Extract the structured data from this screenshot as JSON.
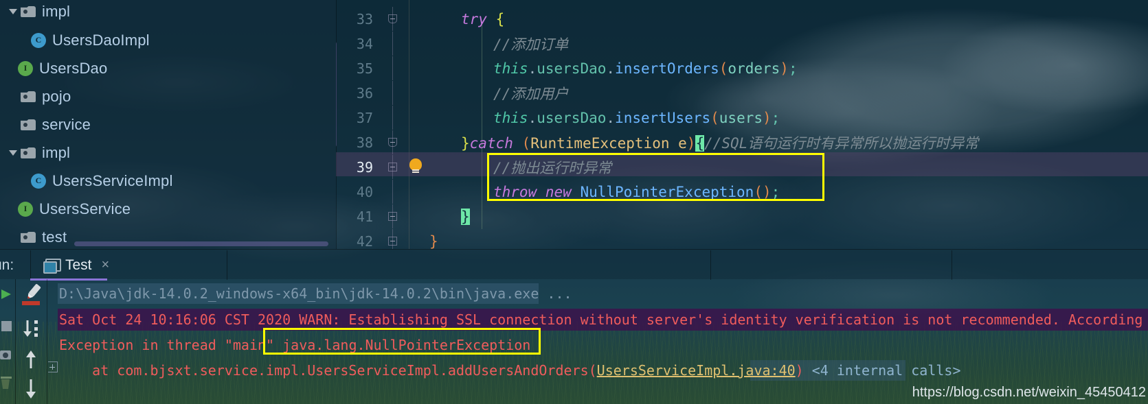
{
  "project_tree": {
    "items": [
      {
        "label": "impl",
        "icon": "folder-icon",
        "arrow": "expanded",
        "indent": 0,
        "kind": "folder"
      },
      {
        "label": "UsersDaoImpl",
        "icon": "class-icon",
        "arrow": "none",
        "indent": 1,
        "kind": "class"
      },
      {
        "label": "UsersDao",
        "icon": "interface-icon",
        "arrow": "none",
        "indent": 1,
        "kind": "interface"
      },
      {
        "label": "pojo",
        "icon": "folder-icon",
        "arrow": "none",
        "indent": 0,
        "kind": "folder"
      },
      {
        "label": "service",
        "icon": "folder-icon",
        "arrow": "none",
        "indent": 0,
        "kind": "folder"
      },
      {
        "label": "impl",
        "icon": "folder-icon",
        "arrow": "expanded",
        "indent": 0,
        "kind": "folder"
      },
      {
        "label": "UsersServiceImpl",
        "icon": "class-icon",
        "arrow": "none",
        "indent": 1,
        "kind": "class"
      },
      {
        "label": "UsersService",
        "icon": "interface-icon",
        "arrow": "none",
        "indent": 1,
        "kind": "interface"
      },
      {
        "label": "test",
        "icon": "folder-icon",
        "arrow": "none",
        "indent": 0,
        "kind": "folder"
      }
    ],
    "badge_letters": {
      "class": "C",
      "interface": "I"
    }
  },
  "editor": {
    "current_line": 39,
    "lines": [
      {
        "no": "33",
        "fold": "pointed"
      },
      {
        "no": "34",
        "fold": "none"
      },
      {
        "no": "35",
        "fold": "none"
      },
      {
        "no": "36",
        "fold": "none"
      },
      {
        "no": "37",
        "fold": "none"
      },
      {
        "no": "38",
        "fold": "pointed"
      },
      {
        "no": "39",
        "fold": "box"
      },
      {
        "no": "40",
        "fold": "none"
      },
      {
        "no": "41",
        "fold": "box"
      },
      {
        "no": "42",
        "fold": "box"
      }
    ],
    "code": {
      "l33_try": "try",
      "l33_brace": "{",
      "l34_comment": "//添加订单",
      "l35_this": "this",
      "l35_dot1": ".",
      "l35_field": "usersDao",
      "l35_dot2": ".",
      "l35_method": "insertOrders",
      "l35_paren_open": "(",
      "l35_arg": "orders",
      "l35_paren_close": ")",
      "l35_semi": ";",
      "l36_comment": "//添加用户",
      "l37_this": "this",
      "l37_dot1": ".",
      "l37_field": "usersDao",
      "l37_dot2": ".",
      "l37_method": "insertUsers",
      "l37_paren_open": "(",
      "l37_arg": "users",
      "l37_paren_close": ")",
      "l37_semi": ";",
      "l38_close_brace": "}",
      "l38_catch": "catch",
      "l38_paren_open": "(",
      "l38_type": "RuntimeException",
      "l38_var": " e",
      "l38_paren_close": ")",
      "l38_brace_matched": "{",
      "l38_comment": "//SQL语句运行时有异常所以抛运行时异常",
      "l39_comment": "//抛出运行时异常",
      "l40_throw": "throw",
      "l40_new": "new",
      "l40_class": "NullPointerException",
      "l40_parens": "()",
      "l40_semi": ";",
      "l41_brace_matched": "}",
      "l42_brace": "}"
    },
    "bulb_tooltip_icon": "lightbulb-icon",
    "highlight_color": "#ffff00"
  },
  "tool_window": {
    "run_label": "un:",
    "tab_title": "Test",
    "tab_close": "×",
    "tab_icon": "run-configuration-icon",
    "toolbar_icons": [
      "soft-wrap-icon",
      "scroll-to-end-icon",
      "up-arrow-icon",
      "down-arrow-icon"
    ],
    "left_strip_icons": [
      "run-icon",
      "stop-icon",
      "camera-icon",
      "trash-icon"
    ]
  },
  "console": {
    "command_line": "D:\\Java\\jdk-14.0.2_windows-x64_bin\\jdk-14.0.2\\bin\\java.exe ...",
    "warning_line": "Sat Oct 24 10:16:06 CST 2020 WARN: Establishing SSL connection without server's identity verification is not recommended. According",
    "exception_prefix": "Exception in thread \"main\" ",
    "exception_class": "java.lang.NullPointerException",
    "stack_prefix": "    at com.bjsxt.service.impl.UsersServiceImpl.addUsersAndOrders(",
    "stack_link": "UsersServiceImpl.java:40",
    "stack_suffix": ")",
    "internal_calls": "<4 internal calls>"
  },
  "watermark": {
    "text": "https://blog.csdn.net/weixin_45450412"
  },
  "colors": {
    "highlight_box": "#ffff00",
    "error_text": "#f05c5c",
    "warn_band": "#3e104c",
    "accent_tab": "#8a74d8",
    "matched_brace": "#6ee7a8",
    "bulb": "#f0a91e"
  }
}
